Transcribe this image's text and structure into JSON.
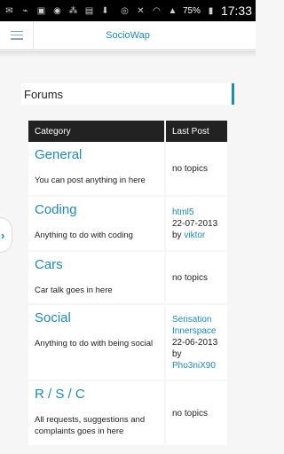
{
  "statusbar": {
    "time": "17:33",
    "battery": "75%"
  },
  "app": {
    "title": "SocioWap"
  },
  "section": {
    "title": "Forums"
  },
  "table": {
    "headers": {
      "category": "Category",
      "last_post": "Last Post"
    },
    "rows": [
      {
        "name": "General",
        "desc": "You can post anything in here",
        "no_topics": "no topics"
      },
      {
        "name": "Coding",
        "desc": "Anything to do with coding",
        "post_title": "html5",
        "post_date": "22-07-2013",
        "by": "by",
        "author": "viktor"
      },
      {
        "name": "Cars",
        "desc": "Car talk goes in here",
        "no_topics": "no topics"
      },
      {
        "name": "Social",
        "desc": "Anything to do with being social",
        "post_title": "Sensation Innerspace",
        "post_date": "22-06-2013",
        "by": "by",
        "author": "Pho3niX90"
      },
      {
        "name": "R / S / C",
        "desc": "All requests, suggestions and complaints goes in here",
        "no_topics": "no topics"
      }
    ]
  },
  "colors": {
    "accent": "#1e8ab8",
    "header_bg": "#222222"
  }
}
